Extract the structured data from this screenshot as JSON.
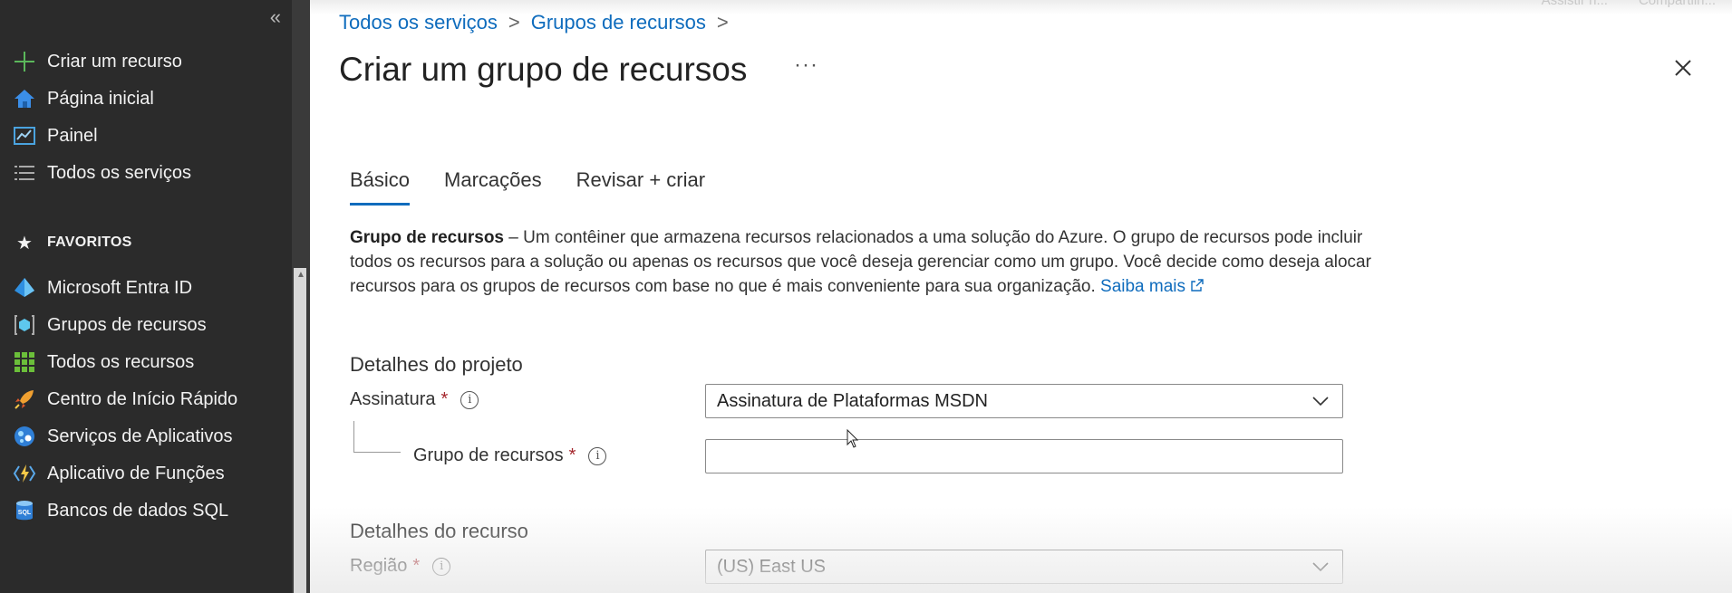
{
  "sidebar": {
    "items": [
      {
        "label": "Criar um recurso",
        "icon": "plus-icon"
      },
      {
        "label": "Página inicial",
        "icon": "home-icon"
      },
      {
        "label": "Painel",
        "icon": "dashboard-icon"
      },
      {
        "label": "Todos os serviços",
        "icon": "list-icon"
      }
    ],
    "favorites_label": "FAVORITOS",
    "favorites": [
      {
        "label": "Microsoft Entra ID",
        "icon": "entra-id-icon"
      },
      {
        "label": "Grupos de recursos",
        "icon": "resource-group-icon"
      },
      {
        "label": "Todos os recursos",
        "icon": "grid-icon"
      },
      {
        "label": "Centro de Início Rápido",
        "icon": "rocket-icon"
      },
      {
        "label": "Serviços de Aplicativos",
        "icon": "app-services-icon"
      },
      {
        "label": "Aplicativo de Funções",
        "icon": "function-app-icon"
      },
      {
        "label": "Bancos de dados SQL",
        "icon": "sql-database-icon"
      }
    ]
  },
  "top_right": [
    "Assistir n...",
    "Compartilh..."
  ],
  "breadcrumb": [
    "Todos os serviços",
    "Grupos de recursos"
  ],
  "page_title": "Criar um grupo de recursos",
  "more_label": "···",
  "tabs": [
    "Básico",
    "Marcações",
    "Revisar + criar"
  ],
  "description": {
    "bold": "Grupo de recursos",
    "text": " – Um contêiner que armazena recursos relacionados a uma solução do Azure. O grupo de recursos pode incluir todos os recursos para a solução ou apenas os recursos que você deseja gerenciar como um grupo. Você decide como deseja alocar recursos para os grupos de recursos com base no que é mais conveniente para sua organização. ",
    "link": "Saiba mais"
  },
  "project_details": {
    "title": "Detalhes do projeto",
    "subscription_label": "Assinatura",
    "subscription_value": "Assinatura de Plataformas MSDN",
    "resource_group_label": "Grupo de recursos",
    "resource_group_value": ""
  },
  "resource_details": {
    "title": "Detalhes do recurso",
    "region_label": "Região",
    "region_value": "(US) East US"
  },
  "required_mark": "*",
  "info_glyph": "i",
  "colors": {
    "accent": "#0f6cbd",
    "sidebar_bg": "#2b2b2b",
    "required": "#a4262c"
  }
}
